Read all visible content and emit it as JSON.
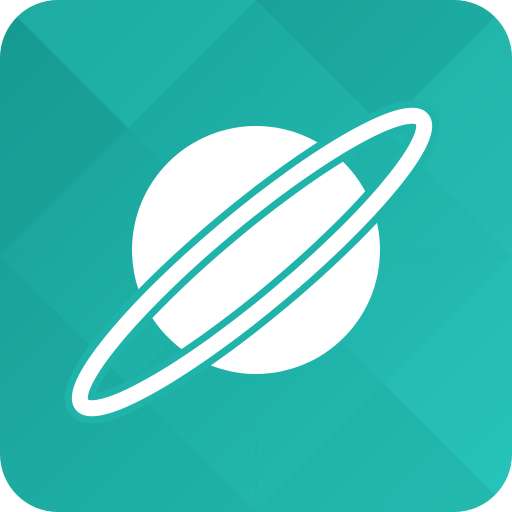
{
  "icon": {
    "name": "planet-icon",
    "colors": {
      "tile_base": "#20b3aa",
      "tile_light": "#27c2b8",
      "tile_dark": "#179c93",
      "facet_light": "#2cc6bc",
      "facet_dark": "#149087",
      "planet": "#ffffff",
      "ring": "#ffffff",
      "ring_gap": "#20b3aa"
    }
  }
}
